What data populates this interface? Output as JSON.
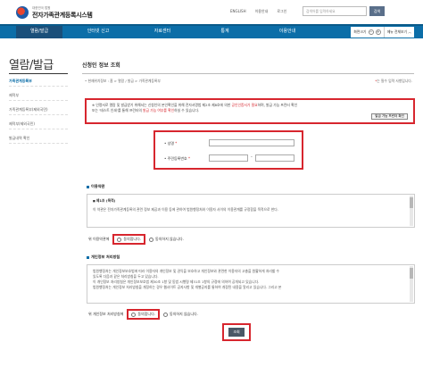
{
  "header": {
    "logo_sub": "대한민국 법원",
    "logo_main": "전자가족관계등록시스템",
    "links": [
      "ENGLISH",
      "이용안내",
      "로그인"
    ],
    "search_placeholder": "검색어를 입력하세요",
    "search_label": "검색"
  },
  "nav": {
    "items": [
      "열람/발급",
      "인터넷 신고",
      "자료센터",
      "통계",
      "이용안내"
    ],
    "right_zoom": "화면크기",
    "right_minus": "−",
    "right_plus": "+",
    "right_menu": "메뉴 전체보기"
  },
  "sidebar": {
    "title": "열람/발급",
    "items": [
      "가족관계등록부",
      "제적부",
      "가족관계등록부(제외국민)",
      "제적부(제외국민)",
      "발급내역 확인"
    ]
  },
  "content": {
    "title": "신청인 정보 조회",
    "breadcrumb": "• 현재위치정보 : 홈 > 열람 / 발급 > 가족관계등록부",
    "required_star": "*",
    "required_text": "는 필수 입력 사항입니다."
  },
  "notice": {
    "text_1": "※ 인명서로 열람 및 발급받기 위해서는 신청인의 본인확인을 위해 전자서명법 제2조 제8호에 의한",
    "hl_1": "공인인증서가 필요",
    "text_2": "하며, 발급 가능 프린터 확인",
    "text_3": "또는 '테스트 인쇄'를 통해 프린터의",
    "hl_2": "발급 가능 여부를 확인",
    "text_4": "하실 수 있습니다.",
    "button": "발급 가능 프린터 확인"
  },
  "form": {
    "name_label": "성명",
    "rrn_label": "주민등록번호",
    "star": "*",
    "dash": "-"
  },
  "terms": {
    "title": "이용약관",
    "sub": "제1조 (목적)",
    "body": "이 약관은 전자가족관계등록의 관련 정보 제공과 이용 등에 관하여 법원행정처와 이용자 사이의 이용관계를 규정함을 목적으로 한다.",
    "agree_label": "위 이용약관에",
    "agree": "동의합니다.",
    "disagree": "동의하지 않습니다."
  },
  "privacy": {
    "title": "개인정보 처리방침",
    "body_1": "법원행정처는 개인정보보호법에 따라 이용자의 개인정보 및 권익을 보호하고 개인정보와 관련한 이용자의 고충을 원활하게 처리할 수",
    "body_2": "있도록 다음과 같은 처리방침을 두고 있습니다.",
    "body_3": "이 개인정보 처리방침은 개인정보보호법 제30조 1항 및 동법 시행령 제31조 1항의 규정에 의하여 공개되고 있습니다.",
    "body_4": "법원행정처는 개인정보 처리방침을 개정하는 경우 웹사이트 공지사항 및 개별공지를 통하여 개정된 내용을 알리고 있습니다. 그리고 본",
    "agree_label": "위 개인정보 처리방침에",
    "agree": "동의합니다.",
    "disagree": "동의하지 않습니다."
  },
  "submit_label": "조회"
}
